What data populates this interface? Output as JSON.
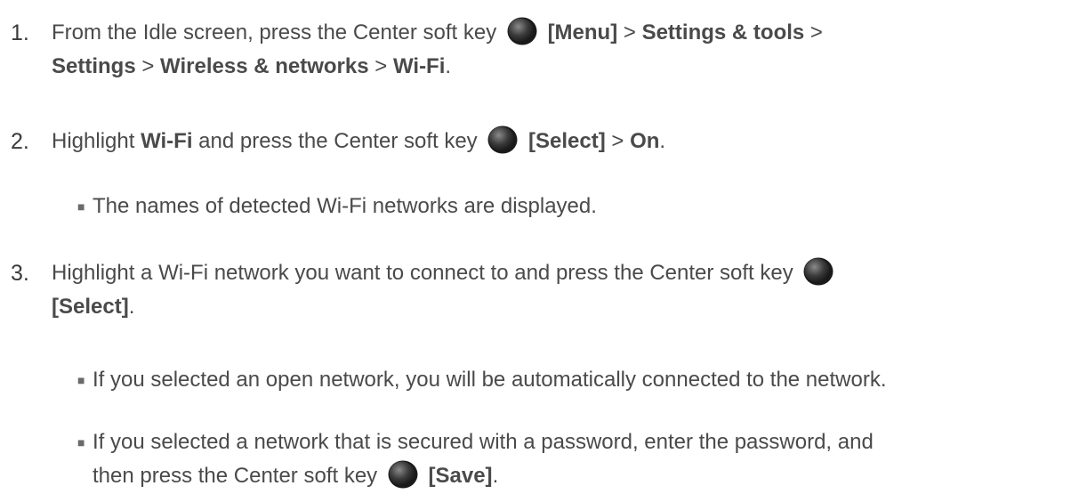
{
  "steps": [
    {
      "number": "1.",
      "line1_pre": "From the Idle screen, press the Center soft key",
      "line1_key_icon": "center-soft-key-icon",
      "line1_menu": "[Menu]",
      "line1_sep": ">",
      "line1_settings_tools": "Settings & tools",
      "line1_sep2": ">",
      "line2_settings": "Settings",
      "line2_sep": ">",
      "line2_wireless": "Wireless & networks",
      "line2_sep2": ">",
      "line2_wifi": "Wi-Fi",
      "line2_end": "."
    },
    {
      "number": "2.",
      "pre": "Highlight",
      "wifi": "Wi-Fi",
      "mid": "and press the Center soft key",
      "select": "[Select]",
      "sep": ">",
      "on": "On",
      "end": "."
    },
    {
      "number": "3.",
      "line1_pre": "Highlight a Wi-Fi network you want to connect to and press the Center soft key",
      "line2_select": "[Select]",
      "line2_end": "."
    }
  ],
  "bullets": {
    "step2": "The names of detected Wi-Fi networks are displayed.",
    "step3_a": "If you selected an open network, you will be automatically connected to the network.",
    "step3_b_line1": "If you selected a network that is secured with a password, enter the password, and",
    "step3_b_line2_pre": "then press the Center soft key",
    "step3_b_save": "[Save]",
    "step3_b_end": "."
  },
  "bullet_glyph": "■"
}
